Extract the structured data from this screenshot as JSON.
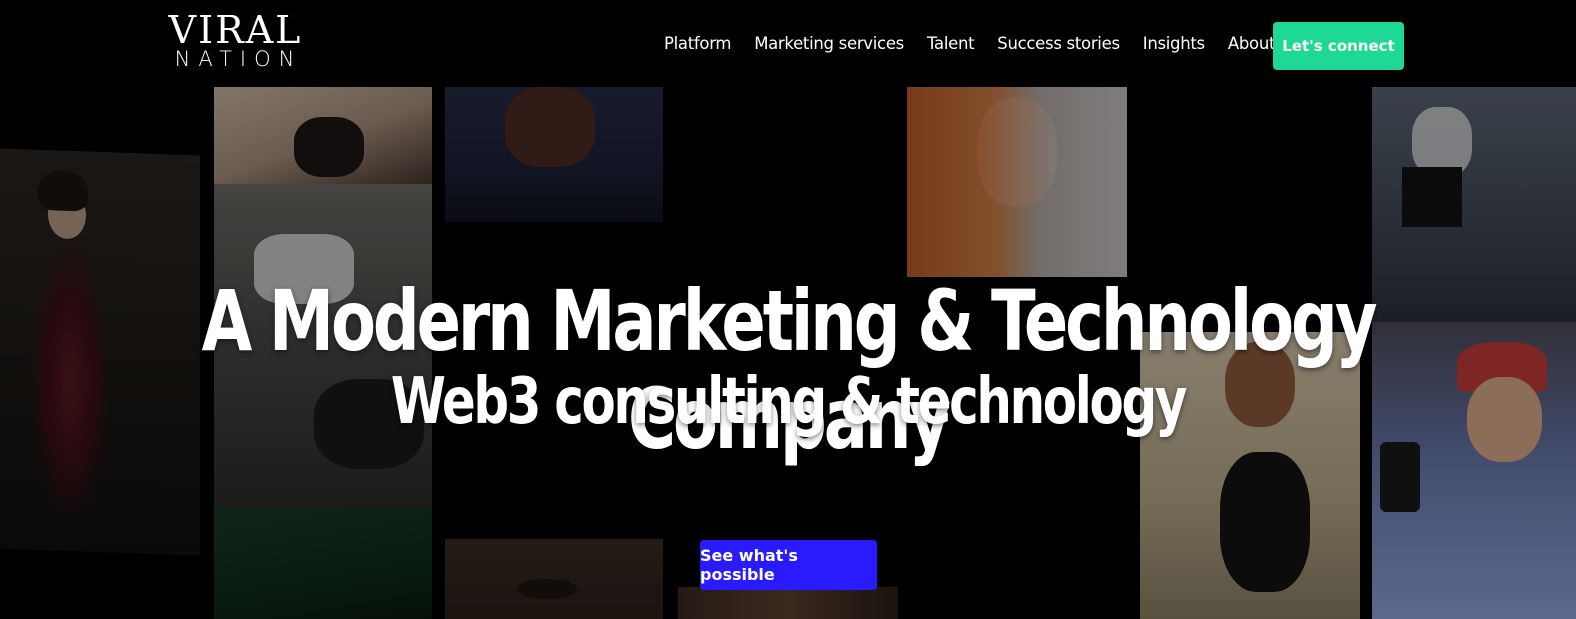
{
  "header": {
    "logo_line1": "VIRAL",
    "logo_line2": "NATION",
    "nav": [
      "Platform",
      "Marketing services",
      "Talent",
      "Success stories",
      "Insights",
      "About"
    ],
    "cta_label": "Let's connect"
  },
  "hero": {
    "title": "A Modern Marketing & Technology Company",
    "subtitle": "Web3 consulting & technology",
    "button_label": "See what's possible"
  },
  "colors": {
    "background": "#000000",
    "cta_green": "#1ed996",
    "hero_button_blue": "#2a1bff",
    "text": "#ffffff"
  }
}
